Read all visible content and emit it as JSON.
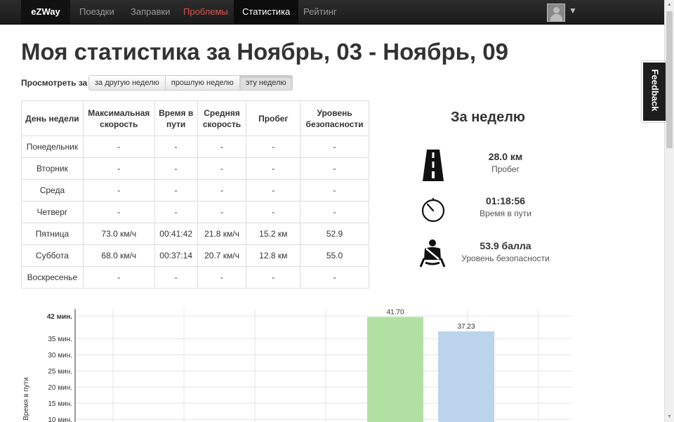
{
  "nav": {
    "brand": "eZWay",
    "items": [
      {
        "label": "Поездки"
      },
      {
        "label": "Заправки"
      },
      {
        "label": "Проблемы"
      },
      {
        "label": "Статистика"
      },
      {
        "label": "Рейтинг"
      }
    ]
  },
  "feedback_label": "Feedback",
  "page_title": "Моя статистика за Ноябрь, 03 - Ноябрь, 09",
  "view": {
    "label": "Просмотреть за",
    "buttons": [
      "за другую неделю",
      "прошлую неделю",
      "эту неделю"
    ],
    "active": "эту неделю"
  },
  "table": {
    "headers": [
      "День недели",
      "Максимальная скорость",
      "Время в пути",
      "Средняя скорость",
      "Пробег",
      "Уровень безопасности"
    ],
    "rows": [
      [
        "Понедельник",
        "-",
        "-",
        "-",
        "-",
        "-"
      ],
      [
        "Вторник",
        "-",
        "-",
        "-",
        "-",
        "-"
      ],
      [
        "Среда",
        "-",
        "-",
        "-",
        "-",
        "-"
      ],
      [
        "Четверг",
        "-",
        "-",
        "-",
        "-",
        "-"
      ],
      [
        "Пятница",
        "73.0 км/ч",
        "00:41:42",
        "21.8 км/ч",
        "15.2 км",
        "52.9"
      ],
      [
        "Суббота",
        "68.0 км/ч",
        "00:37:14",
        "20.7 км/ч",
        "12.8 км",
        "55.0"
      ],
      [
        "Воскресенье",
        "-",
        "-",
        "-",
        "-",
        "-"
      ]
    ]
  },
  "week_summary": {
    "title": "За неделю",
    "items": [
      {
        "value": "28.0 км",
        "label": "Пробег",
        "icon": "road-icon"
      },
      {
        "value": "01:18:56",
        "label": "Время в пути",
        "icon": "stopwatch-icon"
      },
      {
        "value": "53.9 балла",
        "label": "Уровень безопасности",
        "icon": "seatbelt-icon"
      }
    ]
  },
  "chart_data": {
    "type": "bar",
    "ylabel": "Время в пути",
    "yticks": [
      "42 мин.",
      "35 мин.",
      "30 мин.",
      "25 мин.",
      "20 мин.",
      "15 мин.",
      "10 мин."
    ],
    "ytick_values": [
      42,
      35,
      30,
      25,
      20,
      15,
      10
    ],
    "ylim": [
      0,
      42
    ],
    "series": [
      {
        "values": [
          null,
          null,
          null,
          null,
          41.7,
          null,
          null
        ],
        "label": "41.70",
        "color": "#b2e0a3"
      },
      {
        "values": [
          null,
          null,
          null,
          null,
          null,
          37.23,
          null
        ],
        "label": "37.23",
        "color": "#bcd3ec"
      }
    ]
  },
  "colors": {
    "navbar": "#1b1b1b",
    "problems": "#d9534f",
    "bar_friday": "#b2e0a3",
    "bar_saturday": "#bcd3ec"
  }
}
